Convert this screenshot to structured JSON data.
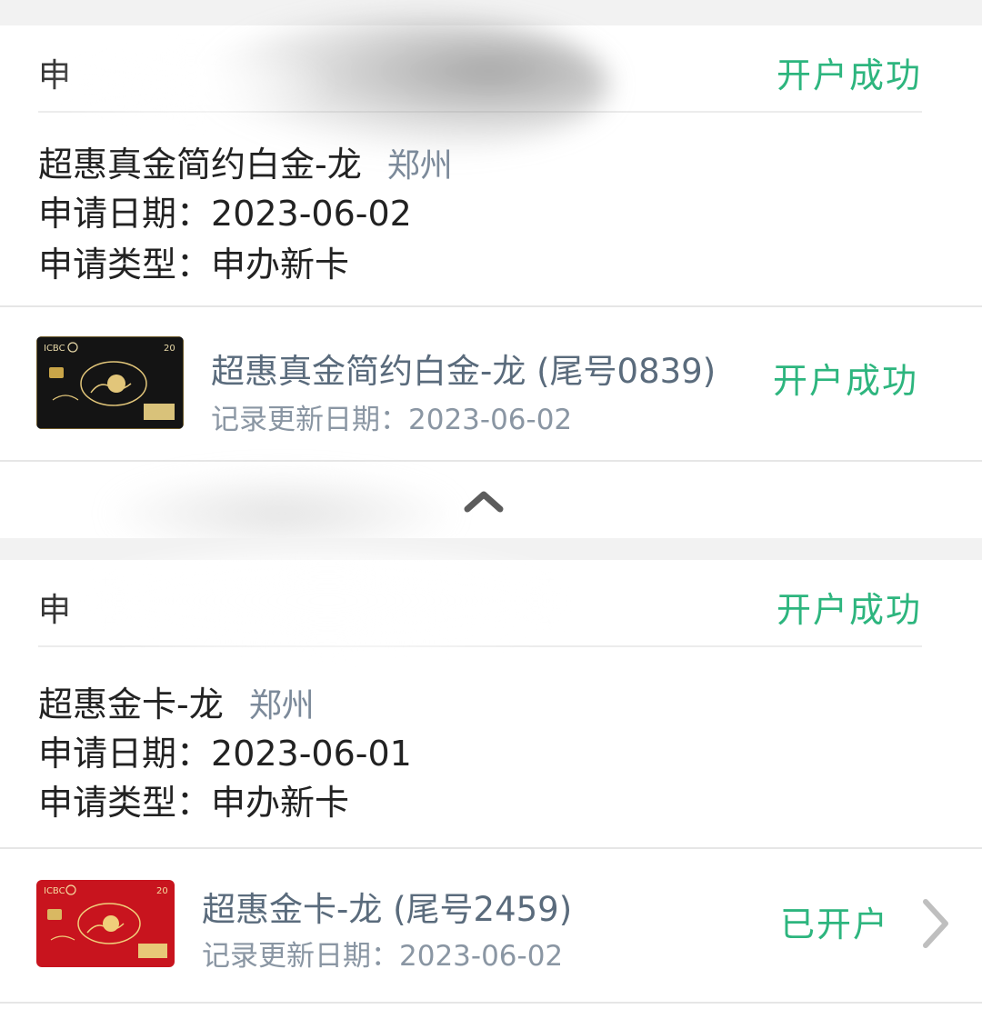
{
  "applications": [
    {
      "header_prefix": "申",
      "header_status": "开户成功",
      "card_name": "超惠真金简约白金-龙",
      "city": "郑州",
      "apply_date_label": "申请日期：",
      "apply_date": "2023-06-02",
      "apply_type_label": "申请类型：",
      "apply_type": "申办新卡",
      "card_item": {
        "title": "超惠真金简约白金-龙 (尾号0839)",
        "update_label": "记录更新日期：",
        "update_date": "2023-06-02",
        "status": "开户成功",
        "card_color": "#141414",
        "bank_mark": "ICBC",
        "badge": "20"
      }
    },
    {
      "header_prefix": "申",
      "header_status": "开户成功",
      "card_name": "超惠金卡-龙",
      "city": "郑州",
      "apply_date_label": "申请日期：",
      "apply_date": "2023-06-01",
      "apply_type_label": "申请类型：",
      "apply_type": "申办新卡",
      "card_item": {
        "title": "超惠金卡-龙 (尾号2459)",
        "update_label": "记录更新日期：",
        "update_date": "2023-06-02",
        "status": "已开户",
        "card_color": "#c8141e",
        "bank_mark": "ICBC",
        "badge": "20"
      }
    }
  ],
  "colors": {
    "status_green": "#2db57e",
    "subtitle_gray": "#5a6b7c",
    "divider": "#e6e6e6"
  },
  "icons": {
    "collapse": "chevron-up-icon",
    "detail": "chevron-right-icon"
  }
}
